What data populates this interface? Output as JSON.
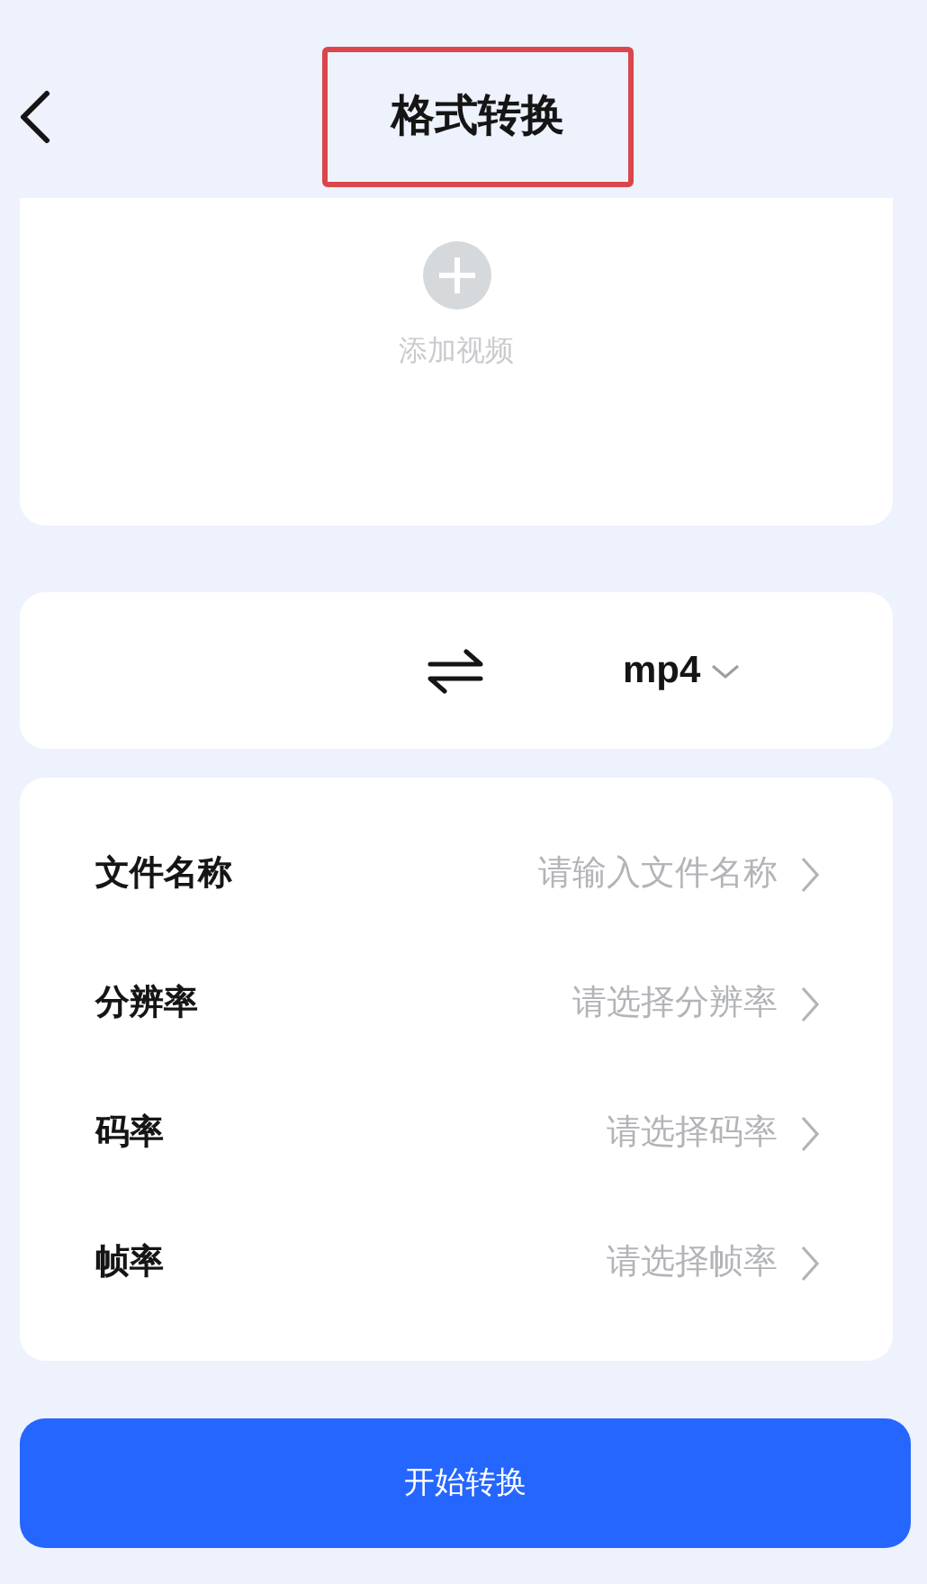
{
  "header": {
    "title": "格式转换",
    "title_highlighted": true
  },
  "upload": {
    "label": "添加视频"
  },
  "format": {
    "value": "mp4"
  },
  "settings": [
    {
      "label": "文件名称",
      "placeholder": "请输入文件名称"
    },
    {
      "label": "分辨率",
      "placeholder": "请选择分辨率"
    },
    {
      "label": "码率",
      "placeholder": "请选择码率"
    },
    {
      "label": "帧率",
      "placeholder": "请选择帧率"
    }
  ],
  "button": {
    "label": "开始转换"
  }
}
